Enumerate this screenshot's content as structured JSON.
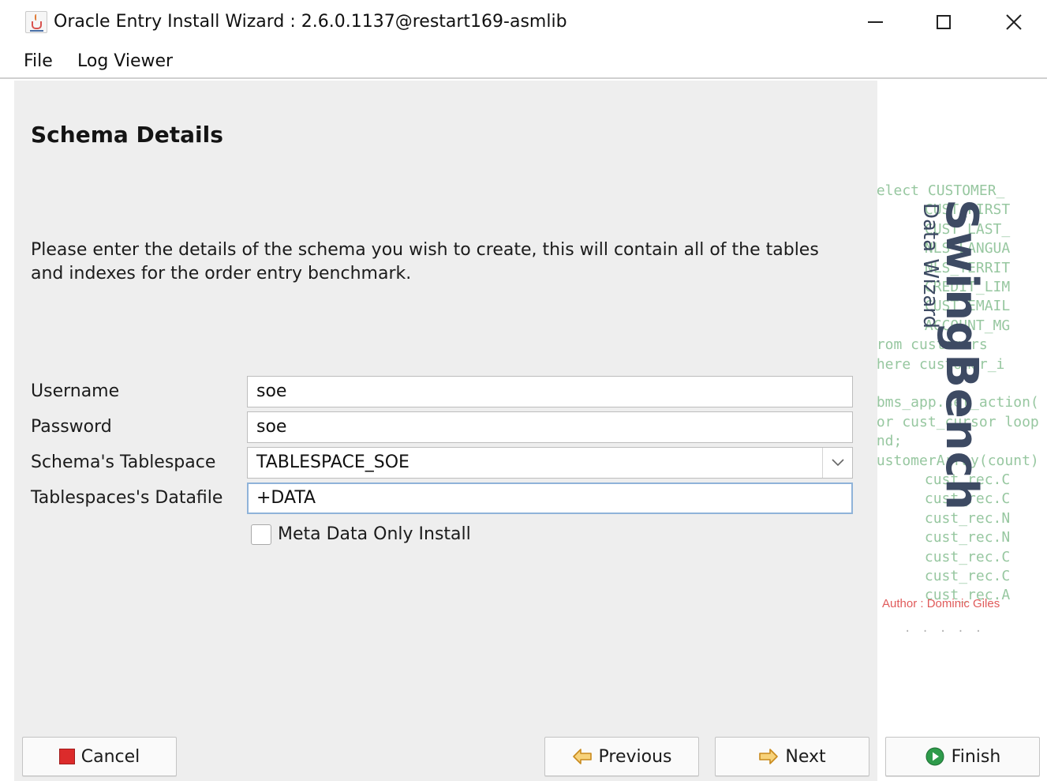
{
  "window": {
    "title": "Oracle Entry Install Wizard : 2.6.0.1137@restart169-asmlib",
    "app_icon": "java-coffee-cup-icon",
    "controls": {
      "minimize": "minimize-icon",
      "maximize": "maximize-icon",
      "close": "close-icon"
    }
  },
  "menu": {
    "file": "File",
    "log_viewer": "Log Viewer"
  },
  "main": {
    "heading": "Schema Details",
    "description": "Please enter the details of the schema you wish to create, this will contain all of the tables and indexes for the order entry benchmark.",
    "form": {
      "username": {
        "label": "Username",
        "value": "soe"
      },
      "password": {
        "label": "Password",
        "value": "soe"
      },
      "tablespace": {
        "label": "Schema's Tablespace",
        "value": "TABLESPACE_SOE"
      },
      "datafile": {
        "label": "Tablespaces's Datafile",
        "value": "+DATA"
      },
      "meta_only": {
        "label": "Meta Data Only Install",
        "checked": false
      }
    }
  },
  "banner": {
    "brand": "SwingBench",
    "subtitle": "Data Wizard",
    "author": "Author : Dominic Giles",
    "code_lines": [
      "select CUSTOMER_",
      "       CUST_FIRST",
      "       CUST_LAST_",
      "       NLS_LANGUA",
      "       NLS_TERRIT",
      "       CREDIT_LIM",
      "       CUST_EMAIL",
      "       ACCOUNT_MG",
      "from customers",
      "where customer_i",
      "",
      "dbms_app.set_action('g",
      "for cust_cursor loop",
      "end;",
      "CustomerArray(count)",
      "       cust_rec.C",
      "       cust_rec.C",
      "       cust_rec.N",
      "       cust_rec.N",
      "       cust_rec.C",
      "       cust_rec.C",
      "       cust_rec.A"
    ]
  },
  "buttons": {
    "cancel": {
      "label": "Cancel",
      "icon": "stop-icon"
    },
    "previous": {
      "label": "Previous",
      "icon": "arrow-left-icon"
    },
    "next": {
      "label": "Next",
      "icon": "arrow-right-icon"
    },
    "finish": {
      "label": "Finish",
      "icon": "play-circle-icon"
    }
  },
  "colors": {
    "panel_bg": "#eeeeee",
    "focus_border": "#8fb3d9",
    "code_text": "#97c7a0",
    "brand_text": "#3d4a63",
    "author_text": "#e05a5a",
    "cancel_red": "#dc2b2b",
    "arrow_orange": "#e8a33c",
    "finish_green": "#2e9b4b"
  }
}
